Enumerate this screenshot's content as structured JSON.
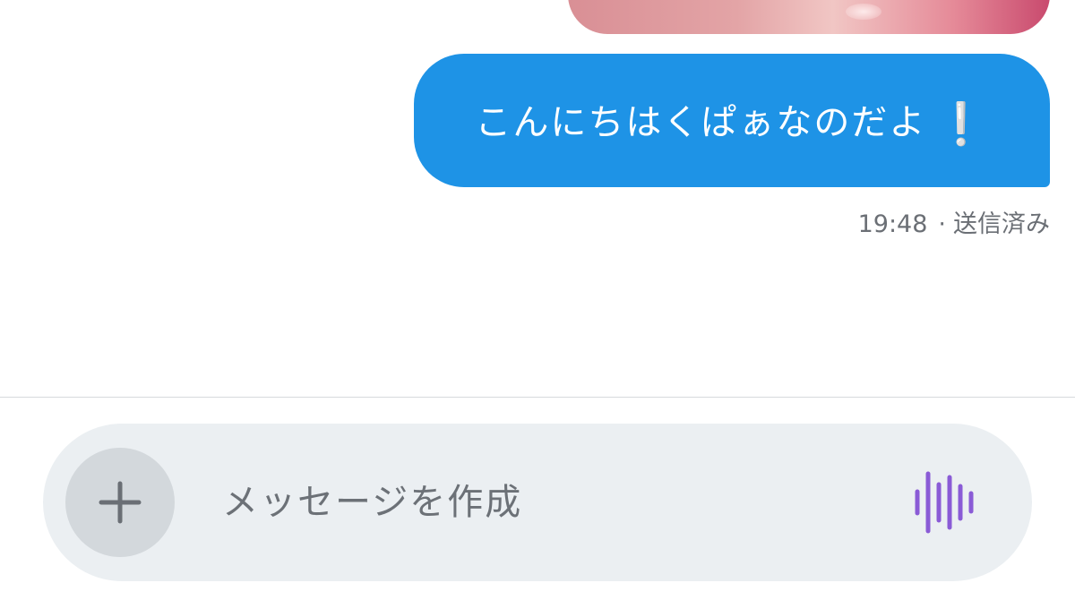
{
  "conversation": {
    "sent_message": {
      "text": "こんにちはくぱぁなのだよ",
      "emoji": "❕",
      "bubble_color": "#1e93e6"
    },
    "meta": {
      "time": "19:48",
      "separator": "·",
      "status": "送信済み"
    }
  },
  "composer": {
    "placeholder": "メッセージを作成",
    "add_icon": "plus-icon",
    "voice_icon": "voice-waveform-icon",
    "voice_color": "#8a5bd6"
  }
}
